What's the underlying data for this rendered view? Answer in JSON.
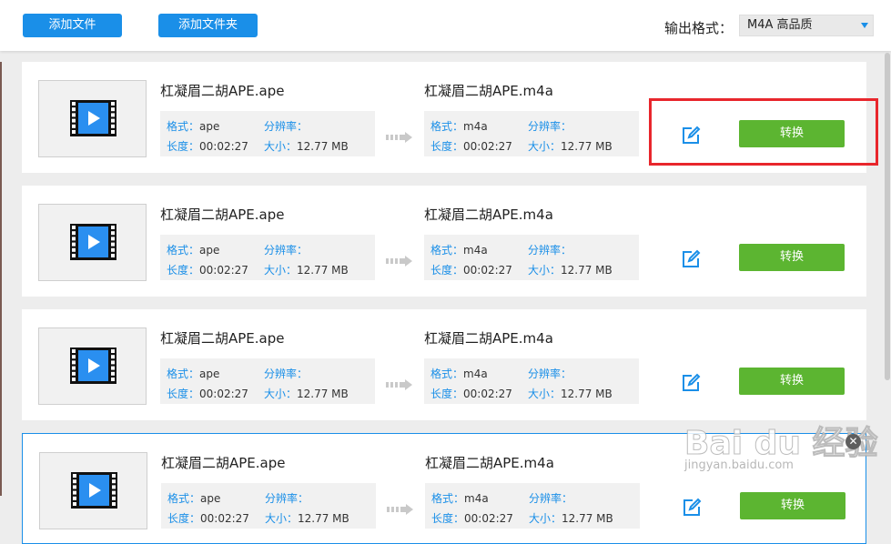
{
  "toolbar": {
    "add_file_label": "添加文件",
    "add_folder_label": "添加文件夹",
    "output_format_label": "输出格式：",
    "output_format_value": "M4A  高品质"
  },
  "labels": {
    "format": "格式：",
    "resolution": "分辨率：",
    "duration": "长度：",
    "size": "大小："
  },
  "files": [
    {
      "source": {
        "name": "杠凝眉二胡APE.ape",
        "format": "ape",
        "resolution": "",
        "duration": "00:02:27",
        "size": "12.77 MB"
      },
      "target": {
        "name": "杠凝眉二胡APE.m4a",
        "format": "m4a",
        "resolution": "",
        "duration": "00:02:27",
        "size": "12.77 MB"
      },
      "convert_label": "转换"
    },
    {
      "source": {
        "name": "杠凝眉二胡APE.ape",
        "format": "ape",
        "resolution": "",
        "duration": "00:02:27",
        "size": "12.77 MB"
      },
      "target": {
        "name": "杠凝眉二胡APE.m4a",
        "format": "m4a",
        "resolution": "",
        "duration": "00:02:27",
        "size": "12.77 MB"
      },
      "convert_label": "转换"
    },
    {
      "source": {
        "name": "杠凝眉二胡APE.ape",
        "format": "ape",
        "resolution": "",
        "duration": "00:02:27",
        "size": "12.77 MB"
      },
      "target": {
        "name": "杠凝眉二胡APE.m4a",
        "format": "m4a",
        "resolution": "",
        "duration": "00:02:27",
        "size": "12.77 MB"
      },
      "convert_label": "转换"
    },
    {
      "source": {
        "name": "杠凝眉二胡APE.ape",
        "format": "ape",
        "resolution": "",
        "duration": "00:02:27",
        "size": "12.77 MB"
      },
      "target": {
        "name": "杠凝眉二胡APE.m4a",
        "format": "m4a",
        "resolution": "",
        "duration": "00:02:27",
        "size": "12.77 MB"
      },
      "convert_label": "转换"
    }
  ],
  "watermark": {
    "logo_text": "Bai du 经验",
    "url": "jingyan.baidu.com"
  },
  "icons": {
    "thumbnail": "video-file-icon",
    "arrow": "convert-arrow-icon",
    "edit": "edit-icon",
    "dropdown": "chevron-down-icon",
    "close": "close-icon"
  },
  "colors": {
    "accent_blue": "#1a8fe8",
    "convert_green": "#5cb531",
    "highlight_red": "#e8262c"
  }
}
